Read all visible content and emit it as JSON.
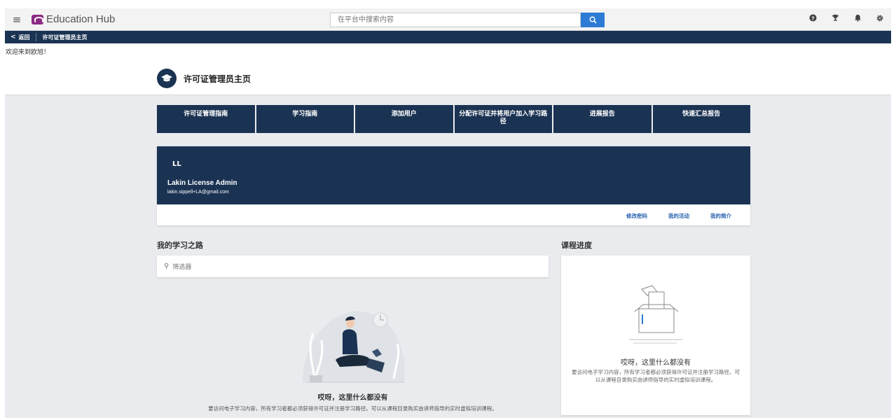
{
  "app": {
    "name": "Education Hub"
  },
  "search": {
    "placeholder": "在平台中搜索内容"
  },
  "nav": {
    "back_label": "返回",
    "breadcrumb": "许可证管理员主页"
  },
  "welcome": "欢迎来到欧旭！",
  "page": {
    "title": "许可证管理员主页"
  },
  "tiles": [
    {
      "label": "许可证管理指南"
    },
    {
      "label": "学习指南"
    },
    {
      "label": "添加用户"
    },
    {
      "label": "分配许可证并将用户加入学习路径"
    },
    {
      "label": "进展报告"
    },
    {
      "label": "快速汇总报告"
    }
  ],
  "profile": {
    "initials": "LL",
    "name": "Lakin License Admin",
    "email": "lakin.sippell+LA@gmail.com",
    "links": [
      "修改密码",
      "我的活动",
      "我的简介"
    ]
  },
  "learning_path": {
    "title": "我的学习之路",
    "filter_label": "筛选器",
    "empty_title": "哎呀，这里什么都没有",
    "empty_desc": "要访问电子学习内容，所有学习者都必须获得许可证并注册学习路径。可以从课程目录购买由讲师指导的实时虚拟培训课程。"
  },
  "course_progress": {
    "title": "课程进度",
    "empty_title": "哎呀，这里什么都没有",
    "empty_desc": "要访问电子学习内容，所有学习者都必须获得许可证并注册学习路径。可以从课程目录购买由讲师指导的实时虚拟培训课程。"
  },
  "colors": {
    "navy": "#1b3353",
    "accent_blue": "#2d7bd4",
    "brand_purple": "#8b2a82",
    "background": "#e9ebee"
  },
  "icons": [
    "menu-icon",
    "search-icon",
    "help-icon",
    "trophy-icon",
    "bell-icon",
    "settings-icon",
    "graduation-cap-icon",
    "filter-icon",
    "chevron-left-icon"
  ]
}
